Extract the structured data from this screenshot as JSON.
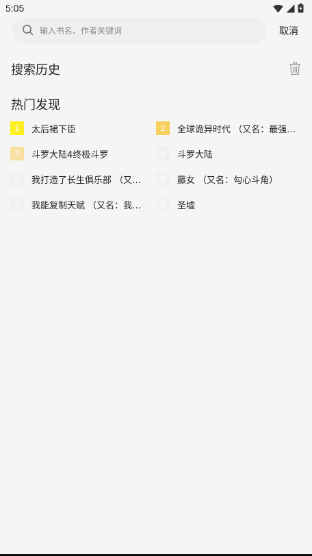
{
  "status_bar": {
    "time": "5:05",
    "icons": [
      "wifi-icon",
      "signal-icon",
      "battery-icon"
    ]
  },
  "search": {
    "placeholder": "输入书名、作者关键词",
    "value": "",
    "cancel_label": "取消"
  },
  "history": {
    "title": "搜索历史",
    "clear_icon": "trash-icon"
  },
  "hot": {
    "title": "热门发现",
    "items": [
      {
        "rank": "1",
        "label": "太后裙下臣",
        "badge_color": "#ffee22"
      },
      {
        "rank": "2",
        "label": "全球诡异时代 （又名：最强…",
        "badge_color": "#f7d160"
      },
      {
        "rank": "3",
        "label": "斗罗大陆4终极斗罗",
        "badge_color": "#f9dfa0"
      },
      {
        "rank": "4",
        "label": "斗罗大陆",
        "badge_color": "#f1f1f1"
      },
      {
        "rank": "5",
        "label": "我打造了长生俱乐部 （又名…",
        "badge_color": "#f1f1f1"
      },
      {
        "rank": "6",
        "label": "藤女 （又名：勾心斗角）",
        "badge_color": "#f1f1f1"
      },
      {
        "rank": "7",
        "label": "我能复制天赋 （又名：我能…",
        "badge_color": "#f1f1f1"
      },
      {
        "rank": "8",
        "label": "圣墟",
        "badge_color": "#f1f1f1"
      }
    ]
  }
}
